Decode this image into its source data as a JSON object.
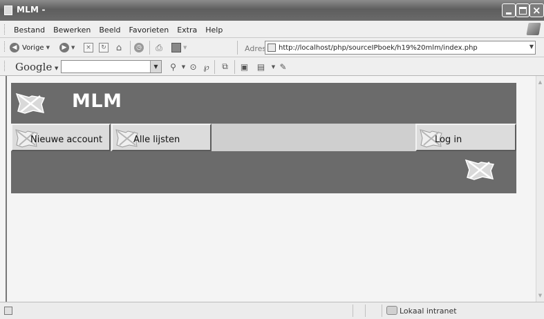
{
  "window": {
    "title": "MLM -",
    "min_glyph": "",
    "close_glyph": "×"
  },
  "menu": {
    "items": [
      "Bestand",
      "Bewerken",
      "Beeld",
      "Favorieten",
      "Extra",
      "Help"
    ]
  },
  "toolbar": {
    "back_label": "Vorige",
    "address_label": "Adres",
    "url": "http://localhost/php/sourceIPboek/h19%20mlm/index.php"
  },
  "google": {
    "logo": "Google",
    "search_value": ""
  },
  "page": {
    "brand": "MLM",
    "nav": [
      {
        "label": "Nieuwe account"
      },
      {
        "label": "Alle lijsten"
      },
      {
        "label": "Log in"
      }
    ]
  },
  "status": {
    "zone": "Lokaal intranet"
  },
  "colors": {
    "header_bg": "#6b6b6b",
    "nav_bg": "#cfcfcf"
  },
  "icons": {
    "broken_image": "broken-image-icon"
  }
}
